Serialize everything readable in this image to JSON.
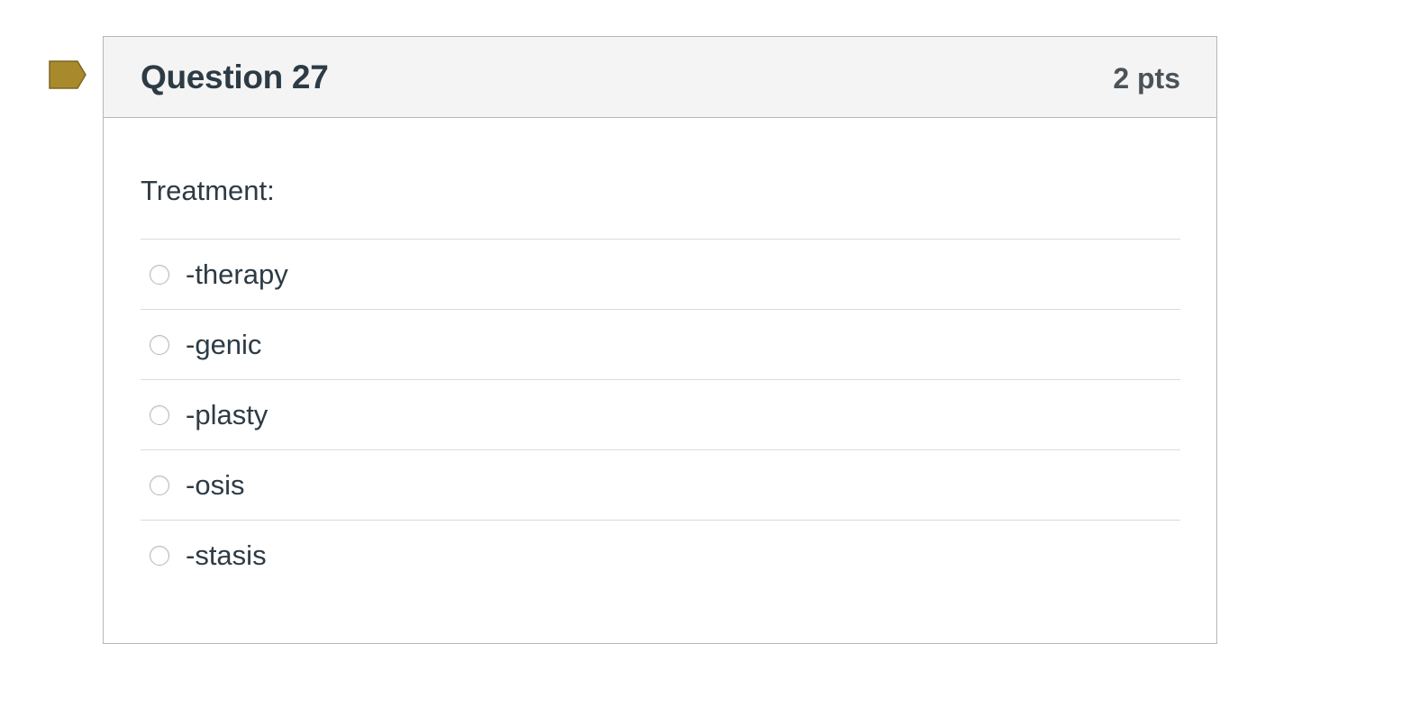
{
  "colors": {
    "flag": "#a88a2c",
    "header_bg": "#f4f4f4",
    "border": "#b4b7ba",
    "text": "#2d3b45",
    "points_text": "#4b5258",
    "divider": "#d9dcde"
  },
  "flag": {
    "icon": "bookmark-flag-icon"
  },
  "question": {
    "title": "Question 27",
    "points": "2 pts",
    "text": "Treatment:",
    "answers": [
      {
        "label": "-therapy",
        "selected": false
      },
      {
        "label": "-genic",
        "selected": false
      },
      {
        "label": "-plasty",
        "selected": false
      },
      {
        "label": "-osis",
        "selected": false
      },
      {
        "label": "-stasis",
        "selected": false
      }
    ]
  }
}
